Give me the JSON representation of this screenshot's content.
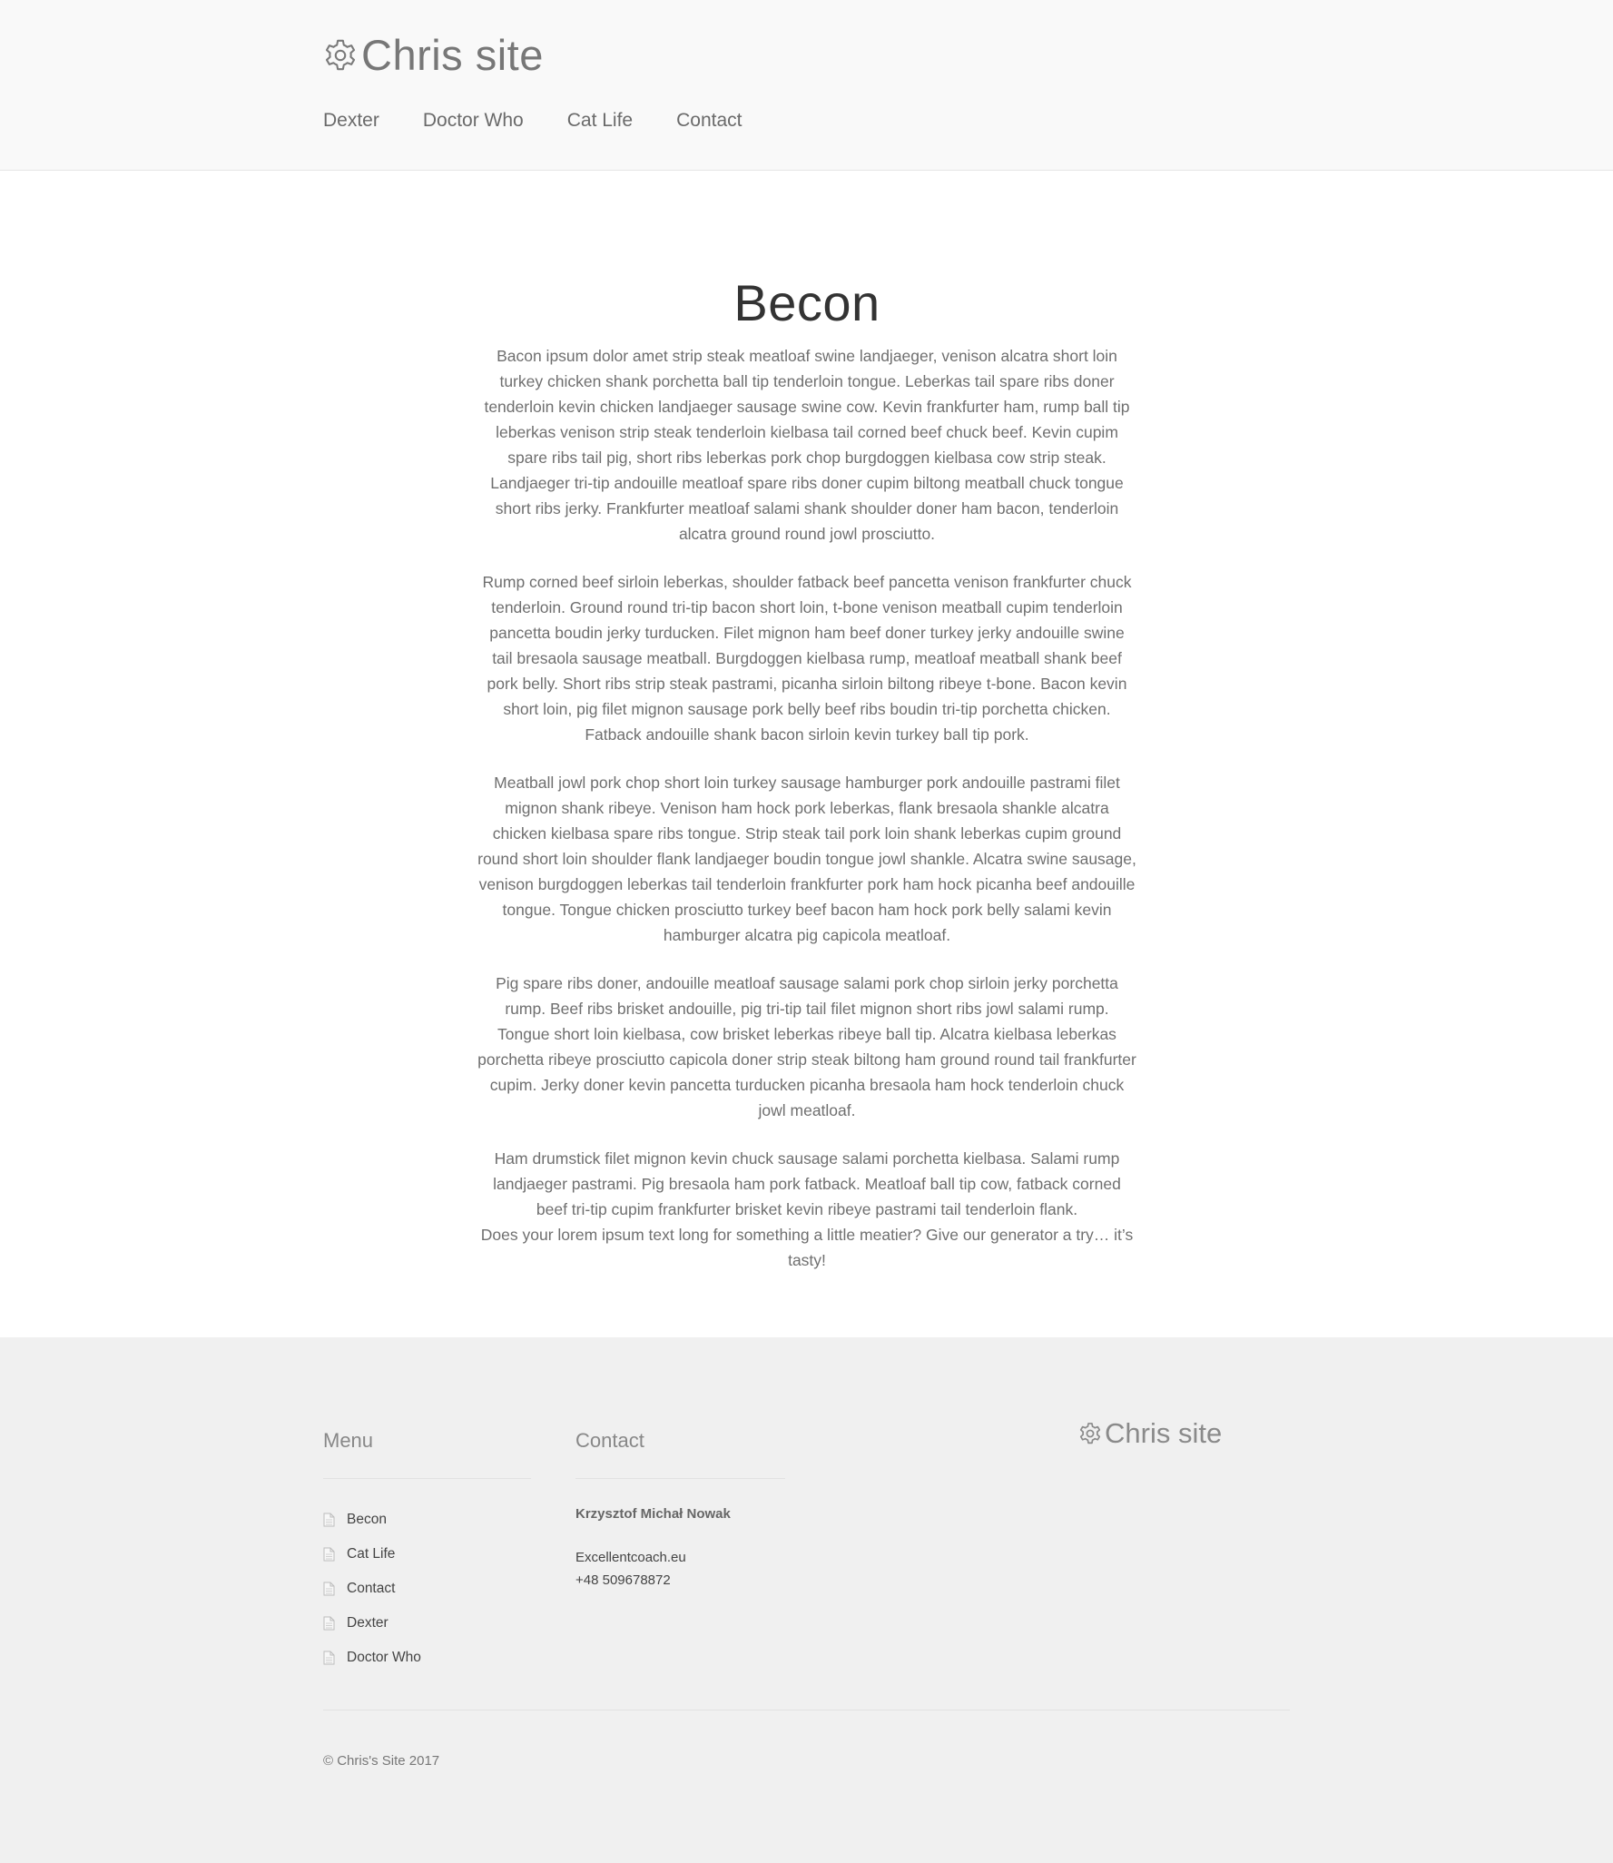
{
  "header": {
    "site_title": "Chris site",
    "logo_icon": "gear-icon",
    "nav": [
      {
        "label": "Dexter"
      },
      {
        "label": "Doctor Who"
      },
      {
        "label": "Cat Life"
      },
      {
        "label": "Contact"
      }
    ]
  },
  "main": {
    "title": "Becon",
    "paragraphs": [
      "Bacon ipsum dolor amet strip steak meatloaf swine landjaeger, venison alcatra short loin turkey chicken shank porchetta ball tip tenderloin tongue. Leberkas tail spare ribs doner tenderloin kevin chicken landjaeger sausage swine cow. Kevin frankfurter ham, rump ball tip leberkas venison strip steak tenderloin kielbasa tail corned beef chuck beef. Kevin cupim spare ribs tail pig, short ribs leberkas pork chop burgdoggen kielbasa cow strip steak. Landjaeger tri-tip andouille meatloaf spare ribs doner cupim biltong meatball chuck tongue short ribs jerky. Frankfurter meatloaf salami shank shoulder doner ham bacon, tenderloin alcatra ground round jowl prosciutto.",
      "Rump corned beef sirloin leberkas, shoulder fatback beef pancetta venison frankfurter chuck tenderloin. Ground round tri-tip bacon short loin, t-bone venison meatball cupim tenderloin pancetta boudin jerky turducken. Filet mignon ham beef doner turkey jerky andouille swine tail bresaola sausage meatball. Burgdoggen kielbasa rump, meatloaf meatball shank beef pork belly. Short ribs strip steak pastrami, picanha sirloin biltong ribeye t-bone. Bacon kevin short loin, pig filet mignon sausage pork belly beef ribs boudin tri-tip porchetta chicken. Fatback andouille shank bacon sirloin kevin turkey ball tip pork.",
      "Meatball jowl pork chop short loin turkey sausage hamburger pork andouille pastrami filet mignon shank ribeye. Venison ham hock pork leberkas, flank bresaola shankle alcatra chicken kielbasa spare ribs tongue. Strip steak tail pork loin shank leberkas cupim ground round short loin shoulder flank landjaeger boudin tongue jowl shankle. Alcatra swine sausage, venison burgdoggen leberkas tail tenderloin frankfurter pork ham hock picanha beef andouille tongue. Tongue chicken prosciutto turkey beef bacon ham hock pork belly salami kevin hamburger alcatra pig capicola meatloaf.",
      "Pig spare ribs doner, andouille meatloaf sausage salami pork chop sirloin jerky porchetta rump. Beef ribs brisket andouille, pig tri-tip tail filet mignon short ribs jowl salami rump. Tongue short loin kielbasa, cow brisket leberkas ribeye ball tip. Alcatra kielbasa leberkas porchetta ribeye prosciutto capicola doner strip steak biltong ham ground round tail frankfurter cupim. Jerky doner kevin pancetta turducken picanha bresaola ham hock tenderloin chuck jowl meatloaf."
    ],
    "last_paragraph_line1": "Ham drumstick filet mignon kevin chuck sausage salami porchetta kielbasa. Salami rump landjaeger pastrami. Pig bresaola ham pork fatback. Meatloaf ball tip cow, fatback corned beef tri-tip cupim frankfurter brisket kevin ribeye pastrami tail tenderloin flank.",
    "last_paragraph_line2": "Does your lorem ipsum text long for something a little meatier? Give our generator a try… it’s tasty!"
  },
  "footer": {
    "menu_title": "Menu",
    "menu_icon": "page-icon",
    "menu_items": [
      {
        "label": "Becon"
      },
      {
        "label": "Cat Life"
      },
      {
        "label": "Contact"
      },
      {
        "label": "Dexter"
      },
      {
        "label": "Doctor Who"
      }
    ],
    "contact_title": "Contact",
    "contact_name": "Krzysztof Michał Nowak",
    "contact_site": "Excellentcoach.eu",
    "contact_phone": "+48 509678872",
    "brand_title": "Chris site",
    "copyright": "© Chris's Site 2017"
  },
  "colors": {
    "header_bg": "#f9f9f9",
    "footer_bg": "#f0f0f0",
    "text": "#6f6f6f",
    "title": "#333333"
  }
}
